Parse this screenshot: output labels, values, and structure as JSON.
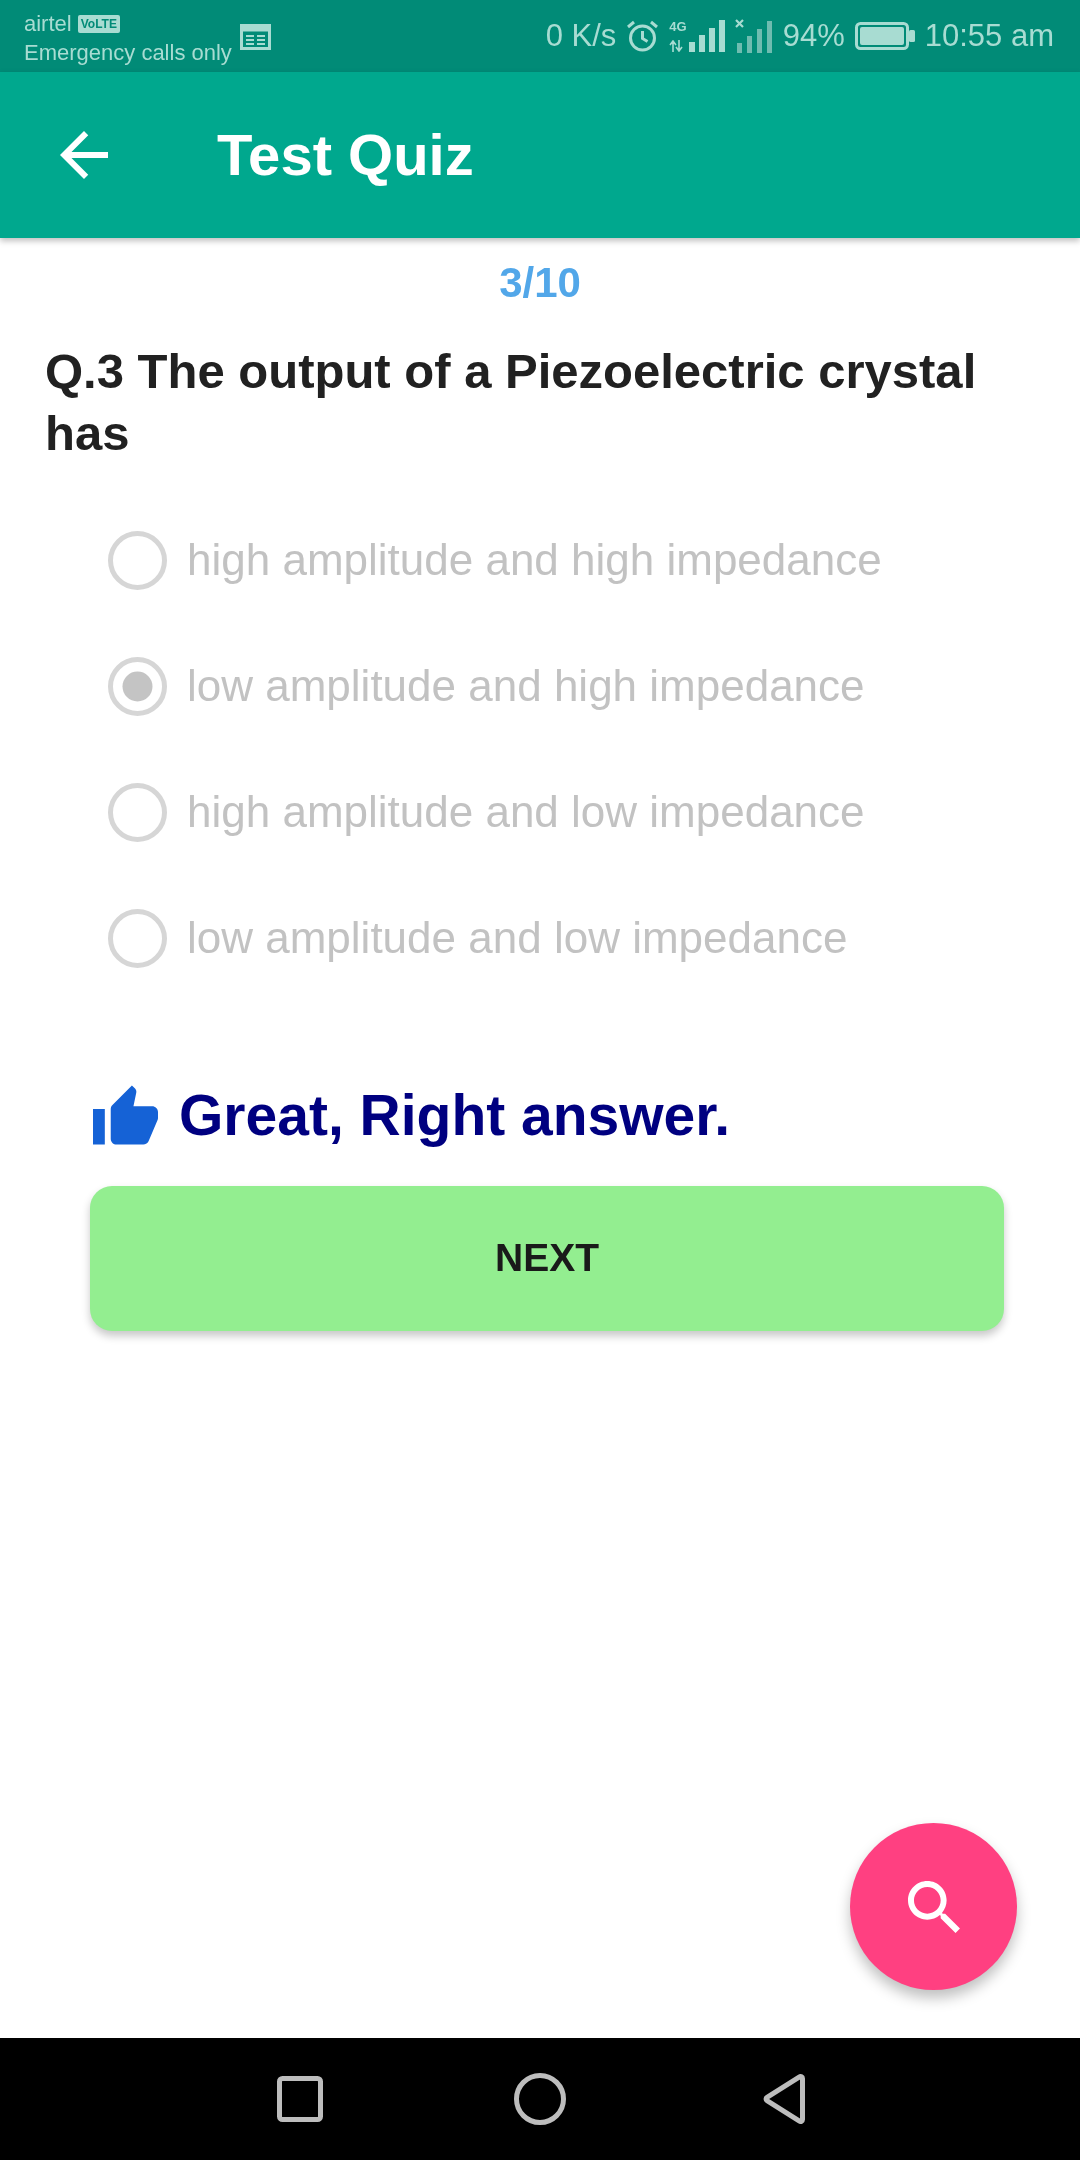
{
  "status_bar": {
    "carrier": "airtel",
    "network_badge": "VoLTE",
    "emergency_text": "Emergency calls only",
    "data_speed": "0 K/s",
    "network_type": "4G",
    "battery": "94%",
    "time": "10:55 am"
  },
  "app_bar": {
    "title": "Test Quiz"
  },
  "quiz": {
    "counter": "3/10",
    "question": "Q.3 The output of a Piezoelectric crystal has",
    "options": [
      {
        "label": "high amplitude and high impedance",
        "selected": false,
        "disabled": true
      },
      {
        "label": "low amplitude and high impedance",
        "selected": true,
        "disabled": true
      },
      {
        "label": "high amplitude and low impedance",
        "selected": false,
        "disabled": true
      },
      {
        "label": "low amplitude and low impedance",
        "selected": false,
        "disabled": true
      }
    ],
    "feedback": {
      "kind": "correct",
      "text": "Great, Right answer."
    },
    "next_button": {
      "label": "NEXT"
    }
  }
}
